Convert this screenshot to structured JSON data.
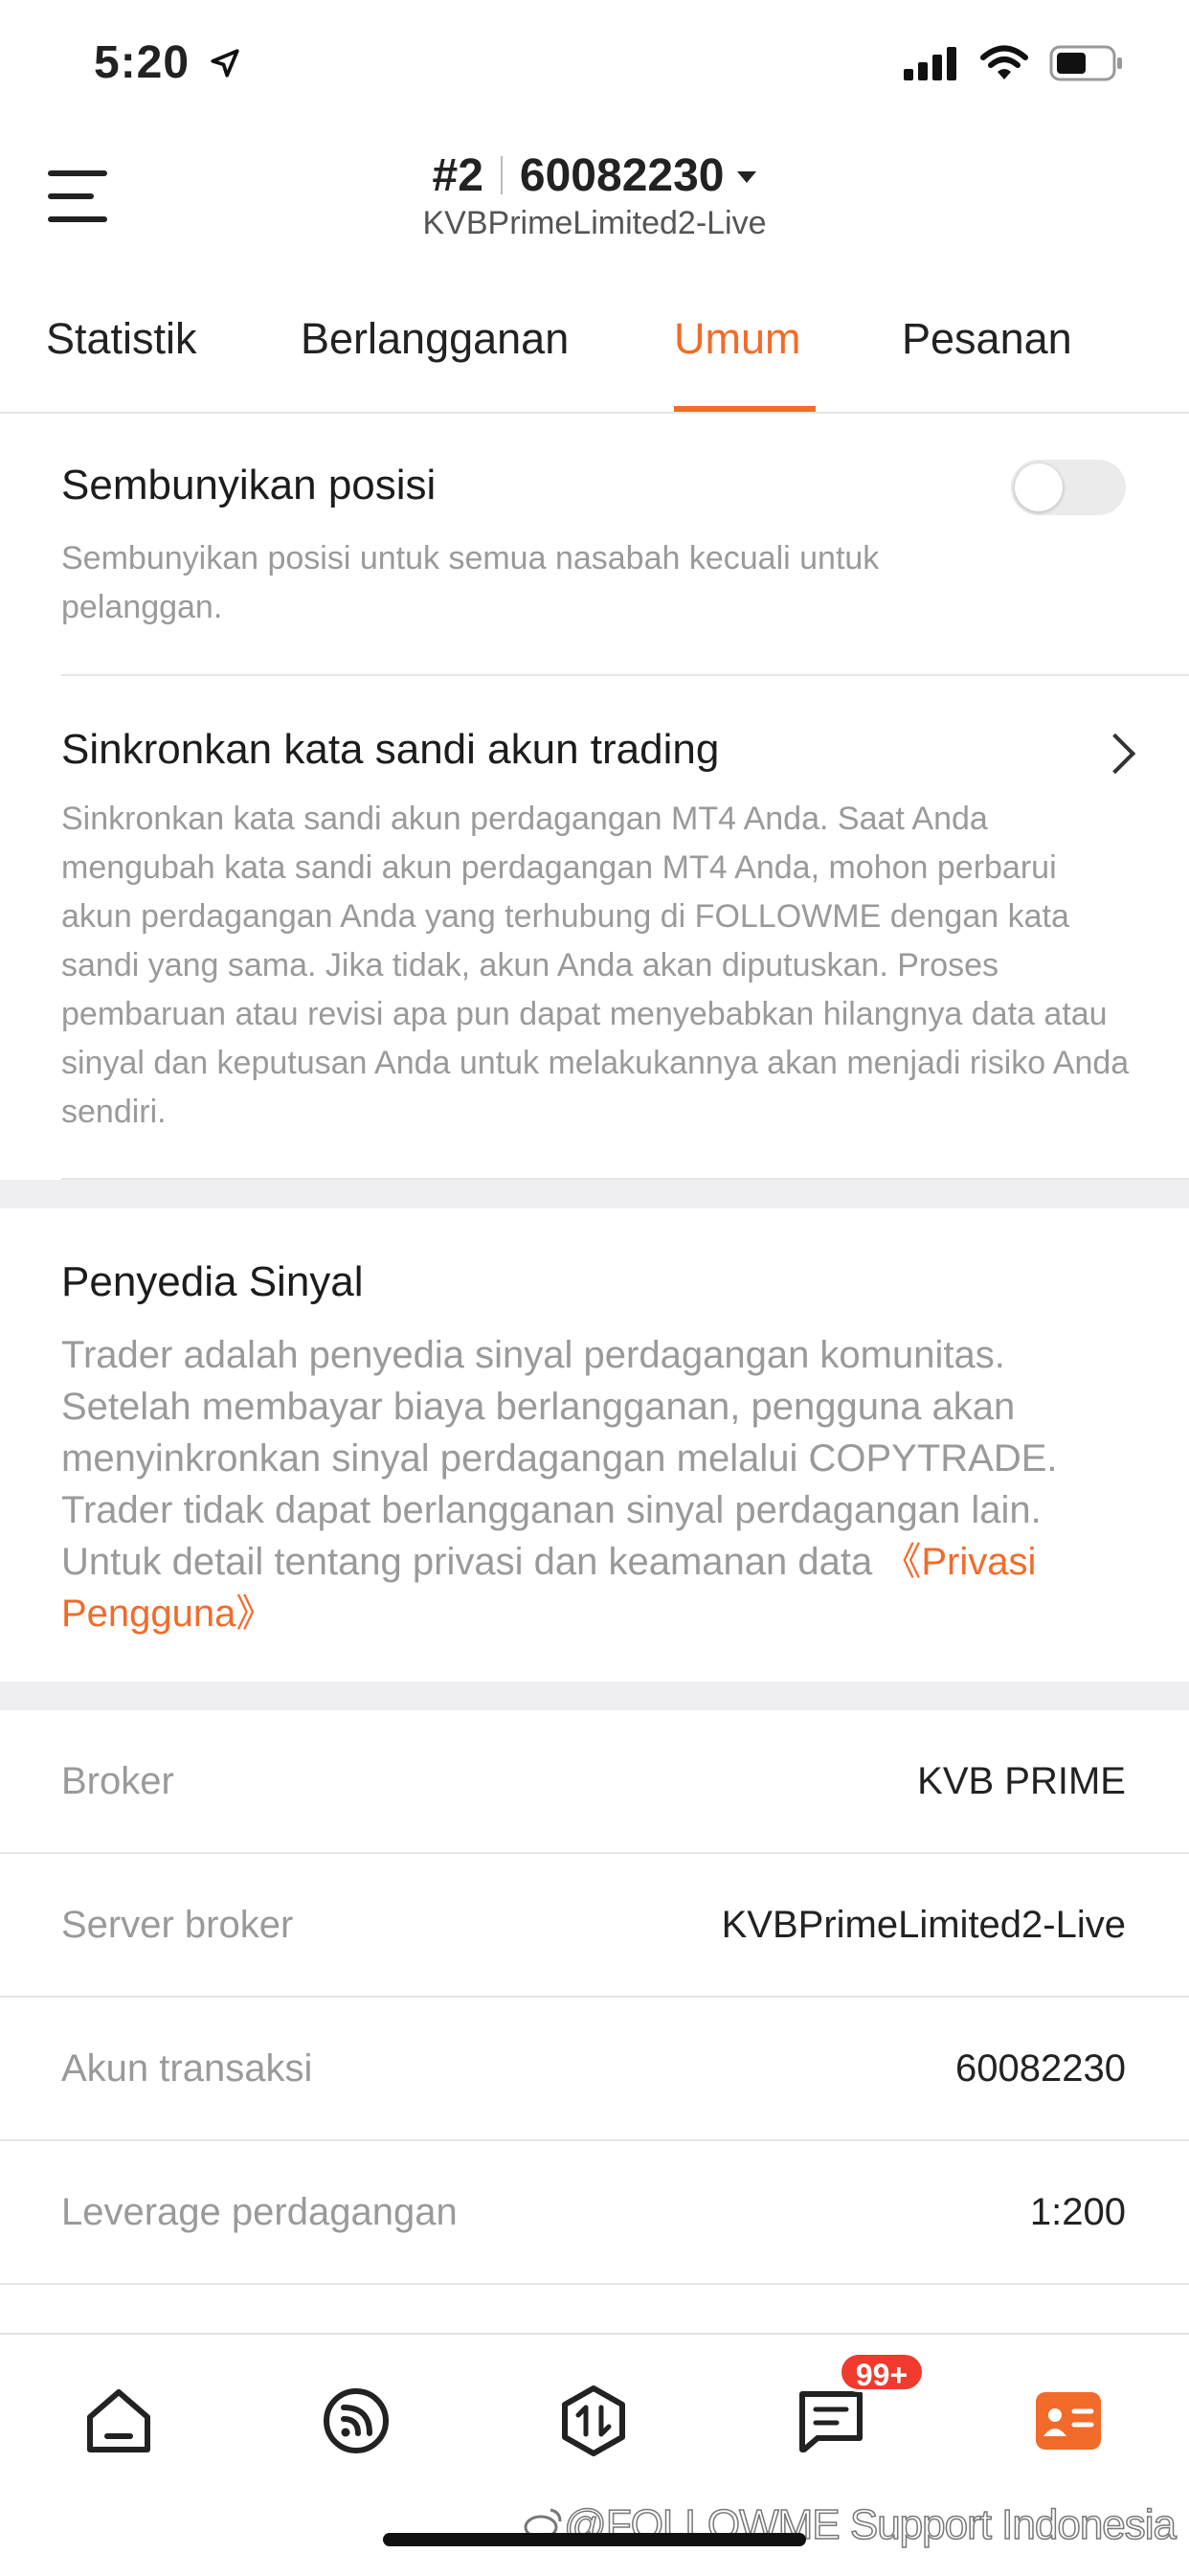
{
  "status_bar": {
    "time": "5:20"
  },
  "header": {
    "account_index": "#2",
    "account_number": "60082230",
    "server": "KVBPrimeLimited2-Live"
  },
  "tabs": [
    {
      "label": "Statistik"
    },
    {
      "label": "Berlangganan"
    },
    {
      "label": "Umum",
      "active": true
    },
    {
      "label": "Pesanan"
    }
  ],
  "settings": {
    "hide_positions": {
      "title": "Sembunyikan posisi",
      "description": "Sembunyikan posisi untuk semua nasabah kecuali untuk pelanggan.",
      "enabled": false
    },
    "sync_password": {
      "title": "Sinkronkan kata sandi akun trading",
      "description": "Sinkronkan kata sandi akun perdagangan MT4 Anda. Saat Anda mengubah kata sandi akun perdagangan MT4 Anda, mohon perbarui akun perdagangan Anda yang terhubung di FOLLOWME dengan kata sandi yang sama. Jika tidak, akun Anda akan diputuskan. Proses pembaruan atau revisi apa pun dapat menyebabkan hilangnya data atau sinyal dan keputusan Anda untuk melakukannya akan menjadi risiko Anda sendiri."
    }
  },
  "signal_provider": {
    "title": "Penyedia Sinyal",
    "description": "Trader adalah penyedia sinyal perdagangan komunitas. Setelah membayar biaya berlangganan, pengguna akan menyinkronkan sinyal perdagangan melalui COPYTRADE. Trader tidak dapat berlangganan sinyal perdagangan lain. Untuk detail tentang privasi dan keamanan data",
    "link": "《Privasi Pengguna》"
  },
  "account_info": [
    {
      "label": "Broker",
      "value": "KVB PRIME"
    },
    {
      "label": "Server broker",
      "value": "KVBPrimeLimited2-Live"
    },
    {
      "label": "Akun transaksi",
      "value": "60082230"
    },
    {
      "label": "Leverage perdagangan",
      "value": "1:200"
    }
  ],
  "bottom_nav": {
    "items": [
      {
        "icon": "home-icon"
      },
      {
        "icon": "feed-icon"
      },
      {
        "icon": "trade-icon"
      },
      {
        "icon": "message-icon"
      },
      {
        "icon": "profile-card-icon"
      }
    ],
    "message_badge": "99+"
  },
  "watermark": "@FOLLOWME Support Indonesia",
  "colors": {
    "accent": "#f26b2a",
    "badge": "#f03a2e"
  }
}
